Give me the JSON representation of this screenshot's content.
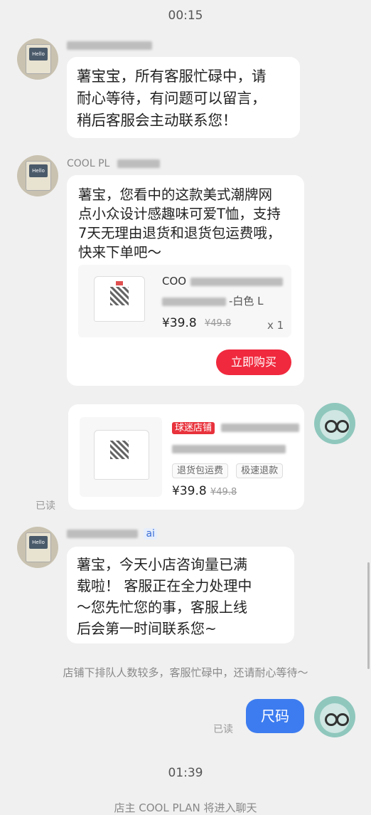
{
  "times": {
    "t1": "00:15",
    "t2": "01:39"
  },
  "messages": {
    "m1": {
      "text_lines": [
        "薯宝宝，所有客服忙碌中，请",
        "耐心等待，有问题可以留言，",
        "稍后客服会主动联系您！"
      ]
    },
    "m2": {
      "sender": "COOL PL",
      "text_lines": [
        "薯宝，您看中的这款美式潮牌网",
        "点小众设计感趣味可爱T恤，支持",
        "7天无理由退货和退货包运费哦，",
        "快来下单吧～"
      ],
      "product": {
        "title": "COO",
        "spec": "-白色 L",
        "price": "¥39.8",
        "old_price": "¥49.8",
        "qty": "x 1",
        "buy_label": "立即购买"
      }
    },
    "m3": {
      "badge": "球迷店铺",
      "tags": [
        "退货包运费",
        "极速退款"
      ],
      "price": "¥39.8",
      "old_price": "¥49.8",
      "read": "已读"
    },
    "m4": {
      "sender_suffix": "ai",
      "text_lines": [
        "薯宝，今天小店咨询量已满",
        "载啦！ 客服正在全力处理中",
        "～您先忙您的事，客服上线",
        "后会第一时间联系您~"
      ]
    },
    "notice": "店铺下排队人数较多，客服忙碌中，还请耐心等待～",
    "m5": {
      "text": "尺码",
      "read": "已读"
    },
    "system": "店主 COOL PLAN 将进入聊天"
  }
}
